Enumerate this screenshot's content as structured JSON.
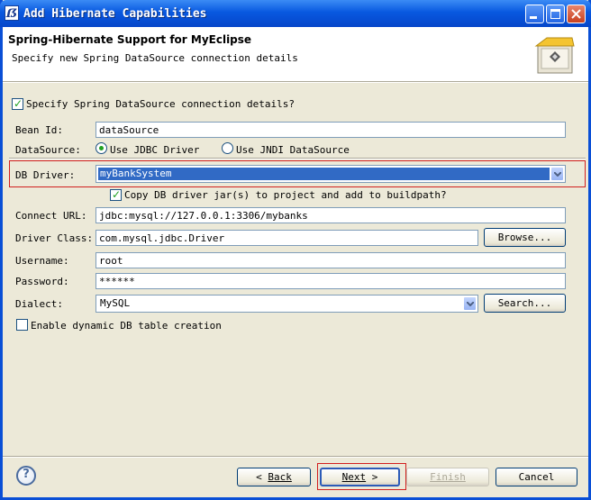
{
  "window": {
    "title": "Add Hibernate Capabilities",
    "app_icon": "eclipse-app-icon",
    "controls": [
      "minimize-icon",
      "maximize-icon",
      "close-icon"
    ]
  },
  "banner": {
    "heading": "Spring-Hibernate Support for MyEclipse",
    "subtitle": "Specify new Spring DataSource connection details",
    "icon": "wizard-package-icon"
  },
  "form": {
    "specify_datasource": {
      "label": "Specify Spring DataSource connection details?",
      "checked": true
    },
    "bean_id": {
      "label": "Bean Id:",
      "value": "dataSource"
    },
    "datasource": {
      "label": "DataSource:",
      "options": [
        {
          "label": "Use JDBC Driver",
          "selected": true
        },
        {
          "label": "Use JNDI DataSource",
          "selected": false
        }
      ]
    },
    "db_driver": {
      "label": "DB Driver:",
      "value": "myBankSystem"
    },
    "copy_jars": {
      "label": "Copy DB driver jar(s) to project and add to buildpath?",
      "checked": true
    },
    "connect_url": {
      "label": "Connect URL:",
      "value": "jdbc:mysql://127.0.0.1:3306/mybanks"
    },
    "driver_class": {
      "label": "Driver Class:",
      "value": "com.mysql.jdbc.Driver",
      "browse_label": "Browse..."
    },
    "username": {
      "label": "Username:",
      "value": "root"
    },
    "password": {
      "label": "Password:",
      "value": "******"
    },
    "dialect": {
      "label": "Dialect:",
      "value": "MySQL",
      "search_label": "Search..."
    },
    "dynamic_table": {
      "label": "Enable dynamic DB table creation",
      "checked": false
    }
  },
  "footer": {
    "help_icon": "help-icon",
    "help_glyph": "?",
    "back_label": "Back",
    "next_label": "Next",
    "finish_label": "Finish",
    "cancel_label": "Cancel"
  },
  "colors": {
    "title_bar": "#0858e0",
    "selection": "#316ac5",
    "highlight_box": "#d11f1f",
    "check": "#21a121"
  }
}
